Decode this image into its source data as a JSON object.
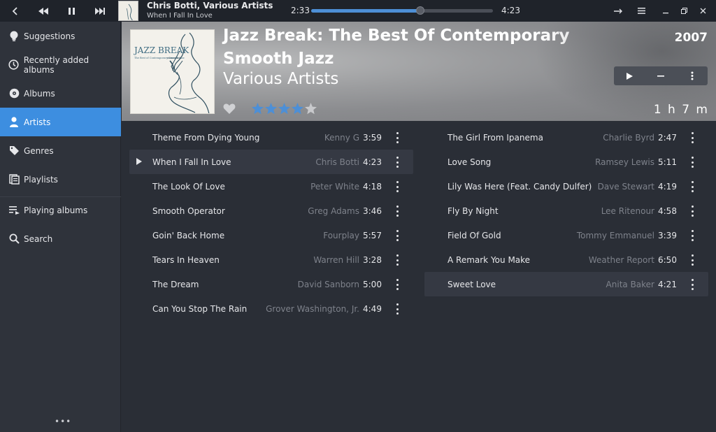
{
  "now_playing": {
    "title": "Chris Botti, Various Artists",
    "subtitle": "When I Fall In Love",
    "elapsed": "2:33",
    "total": "4:23",
    "progress": 0.6
  },
  "sidebar": {
    "items": [
      {
        "label": "Suggestions",
        "icon": "lightbulb-icon"
      },
      {
        "label": "Recently added albums",
        "icon": "clock-icon"
      },
      {
        "label": "Albums",
        "icon": "disc-icon"
      },
      {
        "label": "Artists",
        "icon": "person-icon",
        "active": true
      },
      {
        "label": "Genres",
        "icon": "tag-icon"
      },
      {
        "label": "Playlists",
        "icon": "playlist-icon"
      },
      {
        "label": "Playing albums",
        "icon": "queue-icon"
      },
      {
        "label": "Search",
        "icon": "search-icon"
      }
    ],
    "more": "•••"
  },
  "album": {
    "title": "Jazz Break: The Best Of Contemporary Smooth Jazz",
    "artist": "Various Artists",
    "year": "2007",
    "duration": "1 h 7 m",
    "rating": 4,
    "rating_max": 5,
    "cover_title": "JAZZ BREAK",
    "cover_subtitle": "The Best of Contemporary Smooth Jazz"
  },
  "tracks_left": [
    {
      "title": "Theme From Dying Young",
      "artist": "Kenny G",
      "duration": "3:59"
    },
    {
      "title": "When I Fall In Love",
      "artist": "Chris Botti",
      "duration": "4:23",
      "playing": true
    },
    {
      "title": "The Look Of Love",
      "artist": "Peter White",
      "duration": "4:18"
    },
    {
      "title": "Smooth Operator",
      "artist": "Greg Adams",
      "duration": "3:46"
    },
    {
      "title": "Goin' Back Home",
      "artist": "Fourplay",
      "duration": "5:57"
    },
    {
      "title": "Tears In Heaven",
      "artist": "Warren Hill",
      "duration": "3:28"
    },
    {
      "title": "The Dream",
      "artist": "David Sanborn",
      "duration": "5:00"
    },
    {
      "title": "Can You Stop The Rain",
      "artist": "Grover Washington, Jr.",
      "duration": "4:49"
    }
  ],
  "tracks_right": [
    {
      "title": "The Girl From Ipanema",
      "artist": "Charlie Byrd",
      "duration": "2:47"
    },
    {
      "title": "Love Song",
      "artist": "Ramsey Lewis",
      "duration": "5:11"
    },
    {
      "title": "Lily Was Here (Feat. Candy Dulfer)",
      "artist": "Dave Stewart",
      "duration": "4:19"
    },
    {
      "title": "Fly By Night",
      "artist": "Lee Ritenour",
      "duration": "4:58"
    },
    {
      "title": "Field Of Gold",
      "artist": "Tommy Emmanuel",
      "duration": "3:39"
    },
    {
      "title": "A Remark You Make",
      "artist": "Weather Report",
      "duration": "6:50"
    },
    {
      "title": "Sweet Love",
      "artist": "Anita Baker",
      "duration": "4:21",
      "highlighted": true
    }
  ],
  "colors": {
    "accent": "#3d8ee0",
    "star_filled": "#4d8fd6",
    "star_empty": "#c8c9cc",
    "background": "#2a2e36"
  }
}
